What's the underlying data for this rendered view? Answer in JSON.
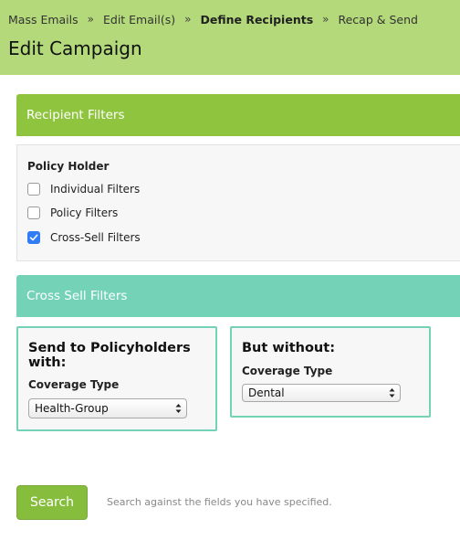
{
  "breadcrumb": {
    "items": [
      "Mass Emails",
      "Edit Email(s)",
      "Define Recipients",
      "Recap & Send"
    ],
    "separator": "»"
  },
  "page_title": "Edit Campaign",
  "recipient_filters": {
    "heading": "Recipient Filters",
    "group_label": "Policy Holder",
    "options": [
      {
        "label": "Individual Filters",
        "checked": false
      },
      {
        "label": "Policy Filters",
        "checked": false
      },
      {
        "label": "Cross-Sell Filters",
        "checked": true
      }
    ]
  },
  "cross_sell": {
    "heading": "Cross Sell Filters",
    "with": {
      "title": "Send to Policyholders with:",
      "field_label": "Coverage Type",
      "selected": "Health-Group"
    },
    "without": {
      "title": "But without:",
      "field_label": "Coverage Type",
      "selected": "Dental"
    }
  },
  "search": {
    "button_label": "Search",
    "hint": "Search against the fields you have specified."
  },
  "colors": {
    "header_bg": "#b3d97a",
    "recipient_header": "#8fc43f",
    "cross_sell_header": "#74d2b7",
    "checkbox_checked": "#2f7cf6",
    "search_button": "#86bd3c"
  }
}
